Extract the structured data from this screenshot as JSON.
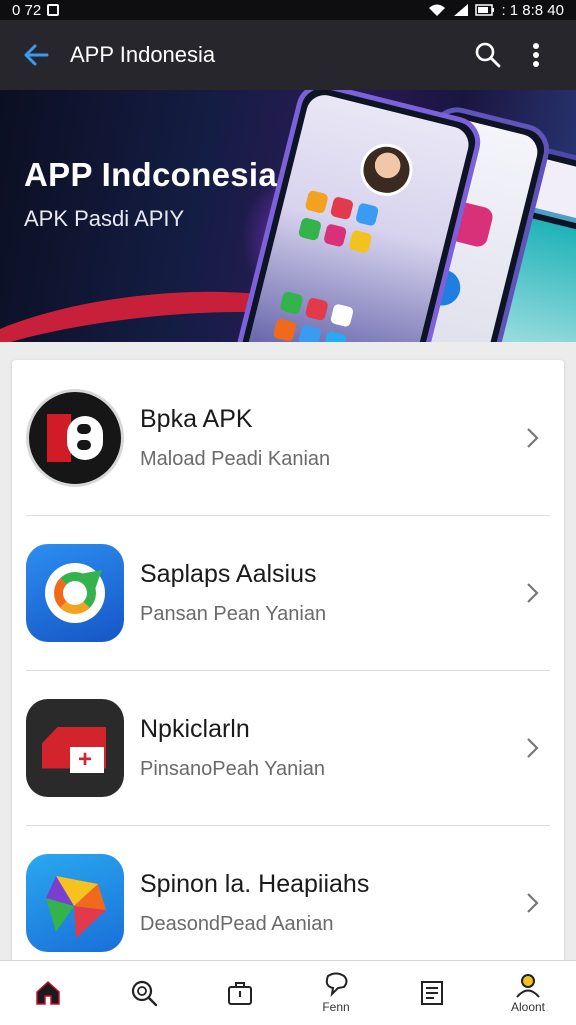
{
  "status_bar": {
    "time": "0 72",
    "right_text": ": 1 8:8 40"
  },
  "app_bar": {
    "title": "APP Indonesia"
  },
  "banner": {
    "title": "APP Indconesia",
    "subtitle": "APK Pasdi APIY"
  },
  "app_list": [
    {
      "name": "Bpka APK",
      "desc": "Maload Peadi Kanian",
      "icon": "black-red-logo-icon"
    },
    {
      "name": "Saplaps Aalsius",
      "desc": "Pansan Pean Yanian",
      "icon": "blue-circular-arrow-icon"
    },
    {
      "name": "Npkiclarln",
      "desc": "PinsanoPeah Yanian",
      "icon": "red-white-plus-icon"
    },
    {
      "name": "Spinon la. Heapiiahs",
      "desc": "DeasondPead Aanian",
      "icon": "colorful-triangles-icon"
    }
  ],
  "bottom_nav": [
    {
      "icon": "home-icon",
      "label": "",
      "active": true
    },
    {
      "icon": "search-icon",
      "label": ""
    },
    {
      "icon": "briefcase-icon",
      "label": ""
    },
    {
      "icon": "chat-icon",
      "label": "Fenn"
    },
    {
      "icon": "document-icon",
      "label": ""
    },
    {
      "icon": "person-icon",
      "label": "Aloont"
    }
  ],
  "colors": {
    "app_bar": "#26262c",
    "accent": "#3a9bf0",
    "background": "#ececec"
  }
}
